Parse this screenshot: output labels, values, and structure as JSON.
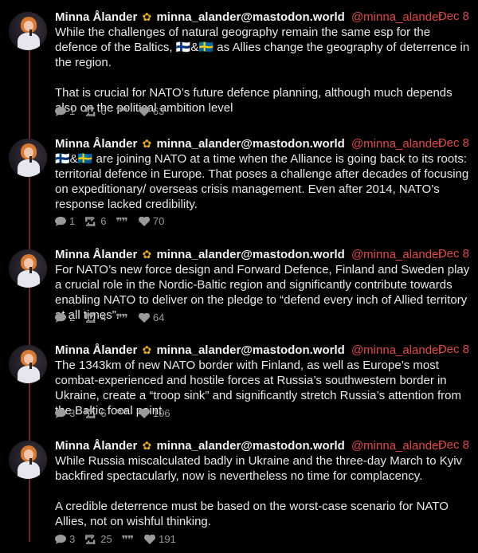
{
  "colors": {
    "accent": "#e0484a",
    "thread_line": "#6b2323",
    "background": "#000000"
  },
  "posts": [
    {
      "name": "Minna Ålander",
      "badge_icon": "sunflower-icon",
      "handle": "minna_alander@mastodon.world",
      "at_handle": "@minna_alander",
      "date": "Dec 8",
      "paragraphs": [
        "While the challenges of natural geography remain the same esp for the defence of the Baltics, 🇫🇮&🇸🇪 as Allies change the geography of deterrence in the region.",
        "That is crucial for NATO’s future defence planning, although much depends also on the political ambition level"
      ],
      "replies": "1",
      "boosts": "6",
      "likes": "63"
    },
    {
      "name": "Minna Ålander",
      "badge_icon": "sunflower-icon",
      "handle": "minna_alander@mastodon.world",
      "at_handle": "@minna_alander",
      "date": "Dec 8",
      "paragraphs": [
        "🇫🇮&🇸🇪 are joining NATO at a time when the Alliance is going back to its roots: territorial defence in Europe. That poses a challenge after decades of focusing on expeditionary/ overseas crisis management. Even after 2014, NATO’s response lacked credibility."
      ],
      "replies": "1",
      "boosts": "6",
      "likes": "70"
    },
    {
      "name": "Minna Ålander",
      "badge_icon": "sunflower-icon",
      "handle": "minna_alander@mastodon.world",
      "at_handle": "@minna_alander",
      "date": "Dec 8",
      "paragraphs": [
        "For NATO’s new force design and Forward Defence, Finland and Sweden play a crucial role in the Nordic-Baltic region and significantly contribute towards enabling NATO to deliver on the pledge to “defend every inch of Allied territory at all times”."
      ],
      "replies": "2",
      "boosts": "4",
      "likes": "64"
    },
    {
      "name": "Minna Ålander",
      "badge_icon": "sunflower-icon",
      "handle": "minna_alander@mastodon.world",
      "at_handle": "@minna_alander",
      "date": "Dec 8",
      "paragraphs": [
        "The 1343km of new NATO border with Finland, as well as Europe’s most combat-experienced and hostile forces at Russia’s southwestern border in Ukraine, create a “troop sink” and significantly stretch Russia’s attention from the Baltic focal point."
      ],
      "replies": "3",
      "boosts": "6",
      "likes": "106"
    },
    {
      "name": "Minna Ålander",
      "badge_icon": "sunflower-icon",
      "handle": "minna_alander@mastodon.world",
      "at_handle": "@minna_alander",
      "date": "Dec 8",
      "paragraphs": [
        "While Russia miscalculated badly in Ukraine and the three-day March to Kyiv backfired spectacularly, now is nevertheless no time for complacency.",
        "A credible deterrence must be based on the worst-case scenario for NATO Allies, not on wishful thinking."
      ],
      "replies": "3",
      "boosts": "25",
      "likes": "191"
    }
  ]
}
